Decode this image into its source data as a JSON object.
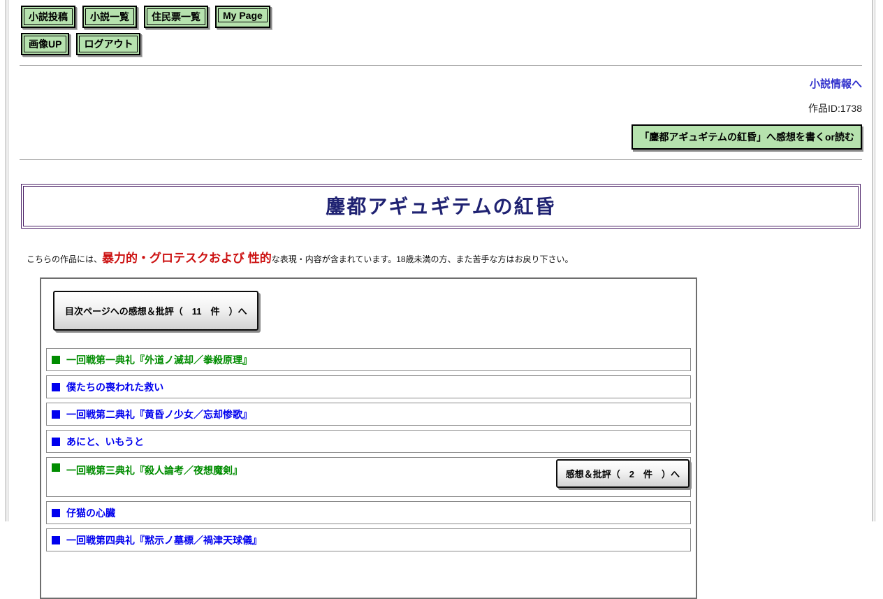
{
  "nav": {
    "row1": [
      "小説投稿",
      "小説一覧",
      "住民票一覧",
      "My Page"
    ],
    "row2": [
      "画像UP",
      "ログアウト"
    ]
  },
  "header": {
    "info_link": "小説情報へ",
    "work_id": "作品ID:1738",
    "feedback_button": "「鏖都アギュギテムの紅昏」へ感想を書くor読む"
  },
  "title": "鏖都アギュギテムの紅昏",
  "warning": {
    "pre": "こちらの作品には、",
    "highlight": "暴力的・グロテスクおよび 性的",
    "post": "な表現・内容が含まれています。18歳未満の方、また苦手な方はお戻り下さい。"
  },
  "toc": {
    "feedback_button": "目次ページへの感想＆批評（　11　件　）へ",
    "chapters": [
      {
        "title": "一回戦第一典礼『外道ノ滅却／拳殺原理』",
        "color": "green"
      },
      {
        "title": "僕たちの喪われた救い",
        "color": "blue"
      },
      {
        "title": "一回戦第二典礼『黄昏ノ少女／忘却惨歌』",
        "color": "blue"
      },
      {
        "title": "あにと、いもうと",
        "color": "blue"
      },
      {
        "title": "一回戦第三典礼『殺人論考／夜想魔剣』",
        "color": "green",
        "feedback_button": "感想＆批評（　2　件　）へ"
      },
      {
        "title": "仔猫の心臓",
        "color": "blue"
      },
      {
        "title": "一回戦第四典礼『黙示ノ墓標／禍津天球儀』",
        "color": "blue"
      }
    ]
  },
  "colors": {
    "button_green_bg": "#b6e2ae",
    "link_navy": "#3030cc",
    "title_navy": "#1f2272",
    "warning_red": "#cc1111",
    "chapter_blue": "#0000ee",
    "chapter_green": "#008c00",
    "banner_border_purple": "#4a2066"
  }
}
